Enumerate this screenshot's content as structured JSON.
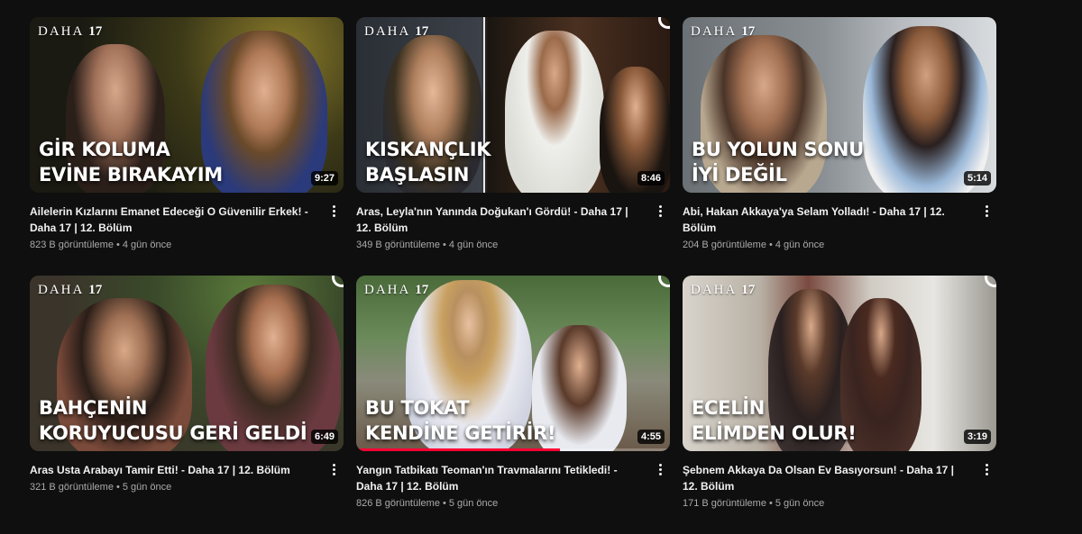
{
  "brand": {
    "logo_word": "DAHA",
    "logo_number": "17"
  },
  "videos": [
    {
      "overlay_lines": [
        "GİR KOLUMA",
        "EVİNE BIRAKAYIM"
      ],
      "duration": "9:27",
      "title": "Ailelerin Kızlarını Emanet Edeceği O Güvenilir Erkek! - Daha 17 | 12. Bölüm",
      "views": "823 B görüntüleme",
      "age": "4 gün önce",
      "progress": 0
    },
    {
      "overlay_lines": [
        "KISKANÇLIK",
        "BAŞLASIN"
      ],
      "duration": "8:46",
      "title": "Aras, Leyla'nın Yanında Doğukan'ı Gördü! - Daha 17 | 12. Bölüm",
      "views": "349 B görüntüleme",
      "age": "4 gün önce",
      "progress": 0
    },
    {
      "overlay_lines": [
        "BU YOLUN SONU",
        "İYİ DEĞİL"
      ],
      "duration": "5:14",
      "title": "Abi, Hakan Akkaya'ya Selam Yolladı! - Daha 17 | 12. Bölüm",
      "views": "204 B görüntüleme",
      "age": "4 gün önce",
      "progress": 0
    },
    {
      "overlay_lines": [
        "BAHÇENİN",
        "KORUYUCUSU GERİ GELDİ"
      ],
      "duration": "6:49",
      "title": "Aras Usta Arabayı Tamir Etti! - Daha 17 | 12. Bölüm",
      "views": "321 B görüntüleme",
      "age": "5 gün önce",
      "progress": 0
    },
    {
      "overlay_lines": [
        "BU TOKAT",
        "KENDİNE GETİRİR!"
      ],
      "duration": "4:55",
      "title": "Yangın Tatbikatı Teoman'ın Travmalarını Tetikledi! - Daha 17 | 12. Bölüm",
      "views": "826 B görüntüleme",
      "age": "5 gün önce",
      "progress": 0.65
    },
    {
      "overlay_lines": [
        "ECELİN",
        "ELİMDEN OLUR!"
      ],
      "duration": "3:19",
      "title": "Şebnem Akkaya Da Olsan Ev Basıyorsun! - Daha 17 | 12. Bölüm",
      "views": "171 B görüntüleme",
      "age": "5 gün önce",
      "progress": 0
    }
  ],
  "colors": {
    "background": "#0f0f0f",
    "progress": "#ff0033",
    "meta_text": "#aaaaaa"
  }
}
